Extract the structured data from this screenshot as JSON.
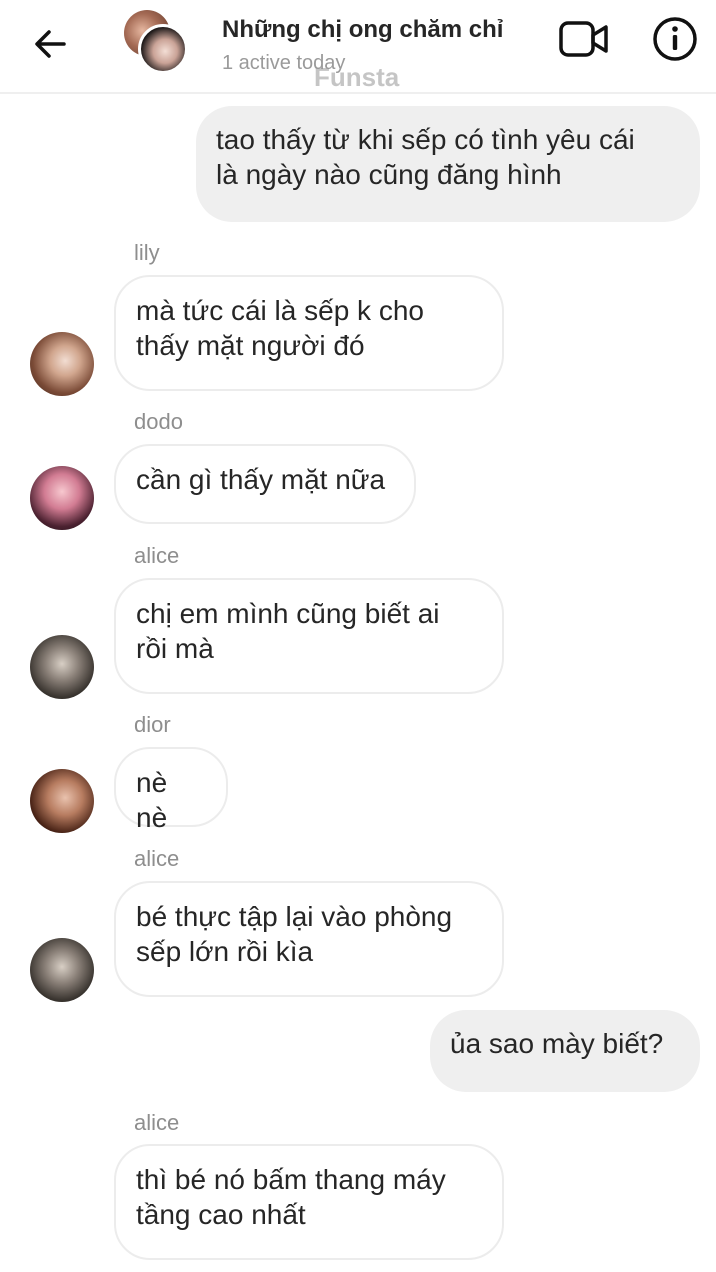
{
  "header": {
    "title": "Những chị ong chăm chỉ",
    "subtitle": "1 active today",
    "watermark": "Funsta"
  },
  "icons": {
    "back": "arrow-left-icon",
    "video": "video-camera-icon",
    "info": "info-icon"
  },
  "messages": [
    {
      "direction": "out",
      "text": "tao thấy từ khi sếp có tình yêu cái\nlà ngày nào cũng đăng hình"
    },
    {
      "direction": "in",
      "sender": "lily",
      "text": "mà tức cái là sếp k cho\nthấy mặt người đó"
    },
    {
      "direction": "in",
      "sender": "dodo",
      "text": "cần gì thấy mặt nữa"
    },
    {
      "direction": "in",
      "sender": "alice",
      "text": "chị em mình cũng biết ai\nrồi mà"
    },
    {
      "direction": "in",
      "sender": "dior",
      "text": "nè nè"
    },
    {
      "direction": "in",
      "sender": "alice",
      "text": "bé thực tập lại vào phòng\nsếp lớn rồi kìa"
    },
    {
      "direction": "out",
      "text": "ủa sao mày biết?"
    },
    {
      "direction": "in",
      "sender": "alice",
      "text": "thì bé nó bấm thang máy\ntầng cao nhất"
    }
  ]
}
